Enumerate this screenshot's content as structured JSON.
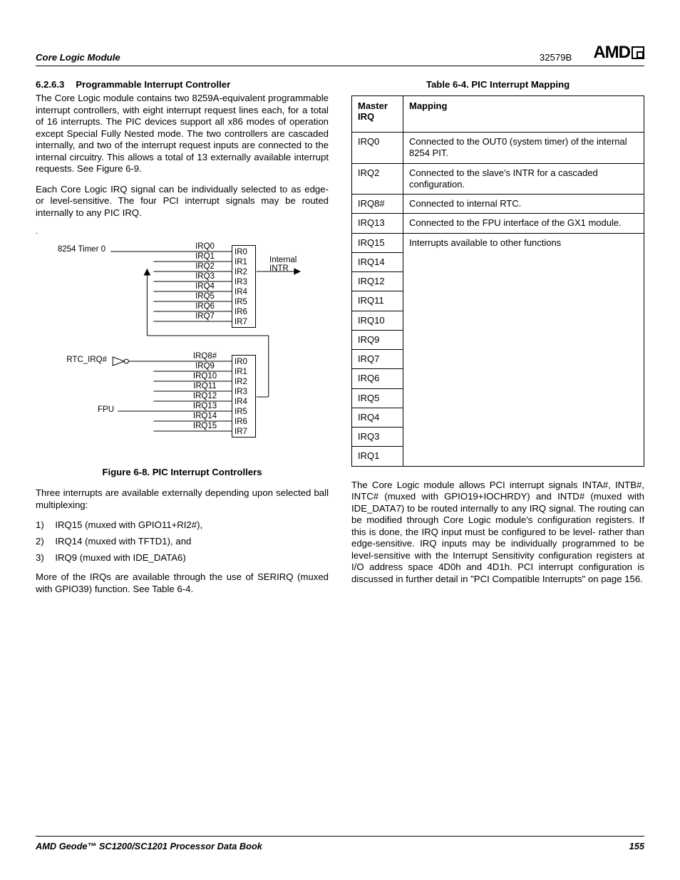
{
  "header": {
    "section": "Core Logic Module",
    "docnum": "32579B",
    "logo": "AMD"
  },
  "footer": {
    "title": "AMD Geode™ SC1200/SC1201 Processor Data Book",
    "page": "155"
  },
  "heading": {
    "num": "6.2.6.3",
    "title": "Programmable Interrupt Controller"
  },
  "para1": "The Core Logic module contains two 8259A-equivalent programmable interrupt controllers, with eight interrupt request lines each, for a total of 16 interrupts. The PIC devices support all x86 modes of operation except Special Fully Nested mode. The two controllers are cascaded internally, and two of the interrupt request inputs are connected to the internal circuitry. This allows a total of 13 externally available interrupt requests. See Figure 6-9.",
  "para2": "Each Core Logic IRQ signal can be individually selected to as edge- or level-sensitive. The four PCI interrupt signals may be routed internally to any PIC IRQ.",
  "figure": {
    "caption": "Figure 6-8.  PIC Interrupt Controllers",
    "labels": {
      "timer": "8254 Timer 0",
      "rtc": "RTC_IRQ#",
      "fpu": "FPU",
      "intr": "Internal\nINTR"
    },
    "pic1IRQ": [
      "IRQ0",
      "IRQ1",
      "IRQ2",
      "IRQ3",
      "IRQ4",
      "IRQ5",
      "IRQ6",
      "IRQ7"
    ],
    "pic1IR": [
      "IR0",
      "IR1",
      "IR2",
      "IR3",
      "IR4",
      "IR5",
      "IR6",
      "IR7"
    ],
    "pic2IRQ": [
      "IRQ8#",
      "IRQ9",
      "IRQ10",
      "IRQ11",
      "IRQ12",
      "IRQ13",
      "IRQ14",
      "IRQ15"
    ],
    "pic2IR": [
      "IR0",
      "IR1",
      "IR2",
      "IR3",
      "IR4",
      "IR5",
      "IR6",
      "IR7"
    ]
  },
  "para3": "Three interrupts are available externally depending upon selected ball multiplexing:",
  "list": [
    "IRQ15 (muxed with GPIO11+RI2#),",
    "IRQ14 (muxed with TFTD1), and",
    "IRQ9 (muxed with IDE_DATA6)"
  ],
  "para4": "More of the IRQs are available through the use of SERIRQ (muxed with GPIO39) function. See Table 6-4.",
  "table": {
    "caption": "Table 6-4.  PIC Interrupt Mapping",
    "head": {
      "c1l1": "Master",
      "c1l2": "IRQ",
      "c2": "Mapping"
    },
    "rows": [
      {
        "irq": "IRQ0",
        "map": "Connected to the OUT0 (system timer) of the internal 8254 PIT."
      },
      {
        "irq": "IRQ2",
        "map": "Connected to the slave's INTR for a cascaded configuration."
      },
      {
        "irq": "IRQ8#",
        "map": "Connected to internal RTC."
      },
      {
        "irq": "IRQ13",
        "map": "Connected to the FPU interface of the GX1 module."
      },
      {
        "irq": "IRQ15",
        "map": "Interrupts available to other functions"
      },
      {
        "irq": "IRQ14",
        "map": ""
      },
      {
        "irq": "IRQ12",
        "map": ""
      },
      {
        "irq": "IRQ11",
        "map": ""
      },
      {
        "irq": "IRQ10",
        "map": ""
      },
      {
        "irq": "IRQ9",
        "map": ""
      },
      {
        "irq": "IRQ7",
        "map": ""
      },
      {
        "irq": "IRQ6",
        "map": ""
      },
      {
        "irq": "IRQ5",
        "map": ""
      },
      {
        "irq": "IRQ4",
        "map": ""
      },
      {
        "irq": "IRQ3",
        "map": ""
      },
      {
        "irq": "IRQ1",
        "map": ""
      }
    ]
  },
  "para5": "The Core Logic module allows PCI interrupt signals INTA#, INTB#, INTC# (muxed with GPIO19+IOCHRDY) and INTD# (muxed with IDE_DATA7) to be routed internally to any IRQ signal. The routing can be modified through Core Logic module's configuration registers. If this is done, the IRQ input must be configured to be level- rather than edge-sensitive. IRQ inputs may be individually programmed to be level-sensitive with the Interrupt Sensitivity configuration registers at I/O address space 4D0h and 4D1h. PCI interrupt configuration is discussed in further detail in \"PCI Compatible Interrupts\" on page 156."
}
